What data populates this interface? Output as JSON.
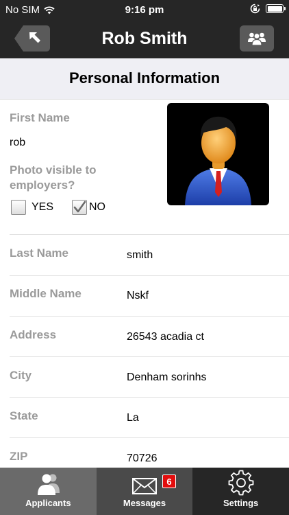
{
  "status_bar": {
    "carrier": "No SIM",
    "time": "9:16 pm"
  },
  "nav": {
    "title": "Rob Smith"
  },
  "section": {
    "title": "Personal Information"
  },
  "first_name": {
    "label": "First Name",
    "value": "rob"
  },
  "photo_visibility": {
    "question": "Photo visible to employers?",
    "options": [
      {
        "label": "YES",
        "checked": false
      },
      {
        "label": "NO",
        "checked": true
      }
    ]
  },
  "fields": [
    {
      "label": "Last Name",
      "value": "smith"
    },
    {
      "label": "Middle Name",
      "value": "Nskf"
    },
    {
      "label": "Address",
      "value": "26543 acadia ct"
    },
    {
      "label": "City",
      "value": "Denham sorinhs"
    },
    {
      "label": "State",
      "value": "La"
    },
    {
      "label": "ZIP",
      "value": "70726"
    }
  ],
  "tabs": [
    {
      "label": "Applicants",
      "icon": "person-icon",
      "selected": true
    },
    {
      "label": "Messages",
      "icon": "envelope-icon",
      "badge": "6"
    },
    {
      "label": "Settings",
      "icon": "gear-icon"
    }
  ]
}
